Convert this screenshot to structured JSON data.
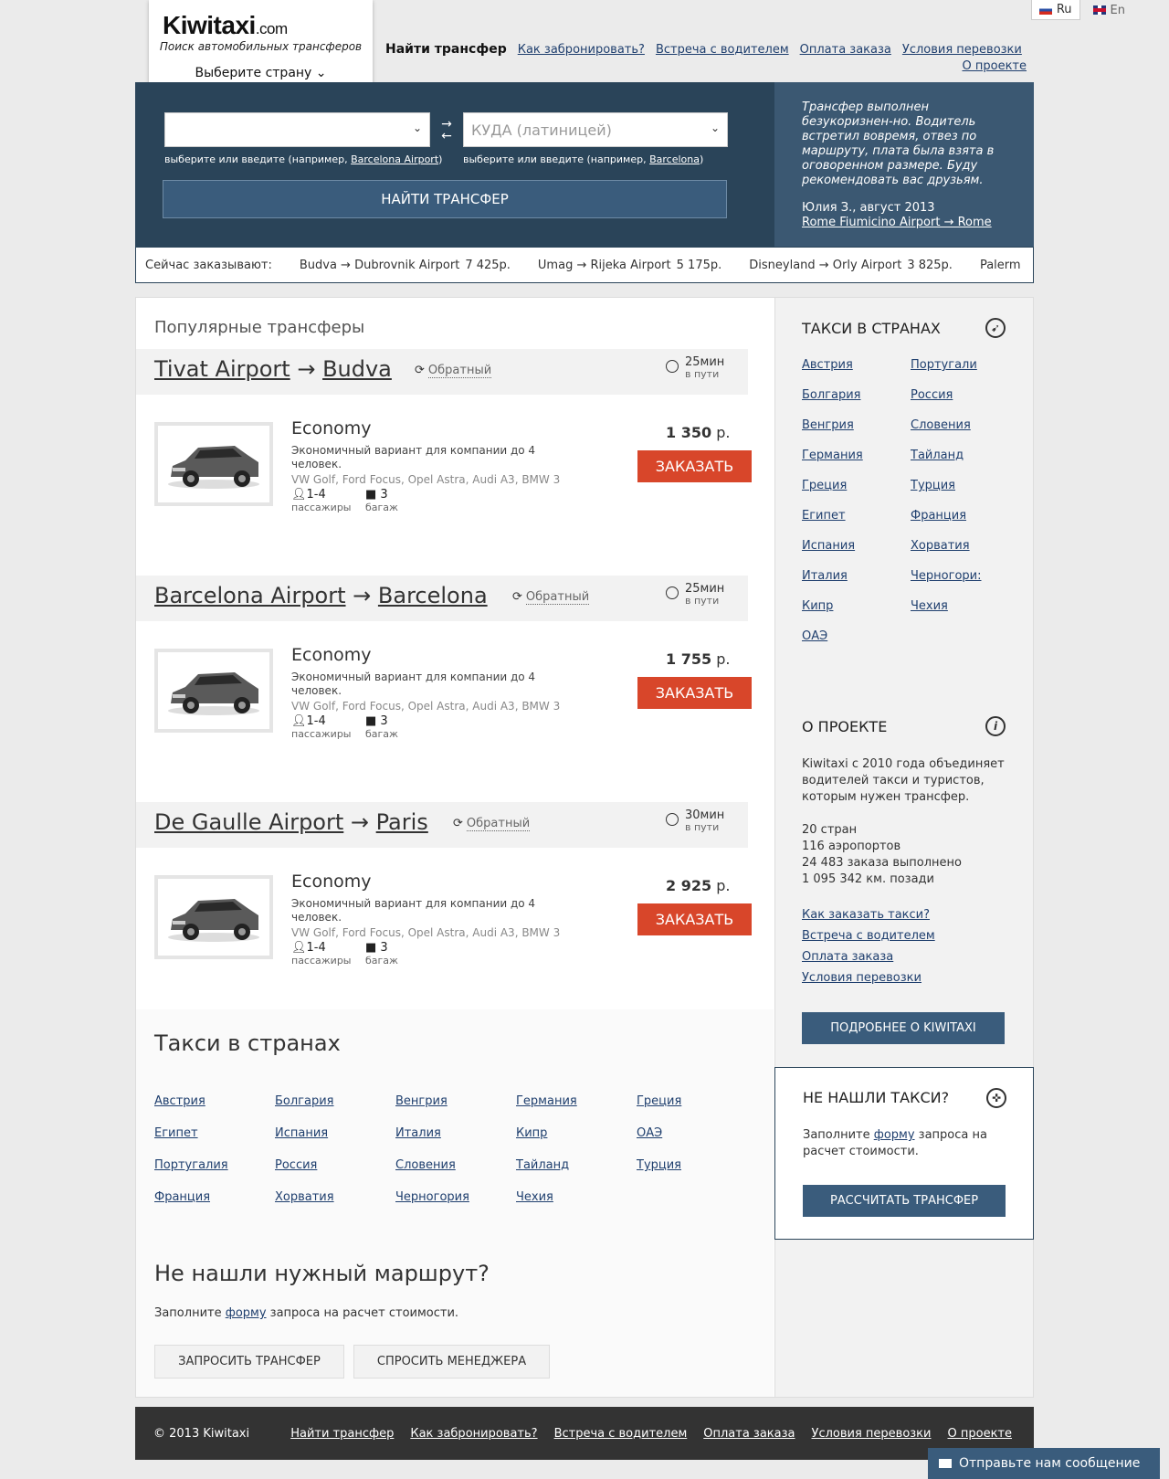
{
  "header": {
    "logo_main": "Kiwitaxi",
    "logo_suffix": ".com",
    "tagline": "Поиск автомобильных трансферов",
    "country_select": "Выберите страну"
  },
  "lang": {
    "ru": "Ru",
    "en": "En"
  },
  "nav": {
    "current": "Найти трансфер",
    "items": [
      "Как забронировать?",
      "Встреча с водителем",
      "Оплата заказа",
      "Условия перевозки"
    ],
    "about": "О проекте"
  },
  "search": {
    "from_value": "",
    "to_placeholder": "КУДА (латиницей)",
    "hint_prefix": "выберите или введите (например, ",
    "hint_suffix": ")",
    "from_example": "Barcelona Airport",
    "to_example": "Barcelona",
    "button": "НАЙТИ ТРАНСФЕР"
  },
  "review": {
    "text": "Трансфер выполнен безукоризнен-но. Водитель встретил вовремя, отвез по маршруту, плата была взята в оговоренном размере. Буду рекомендовать вас друзьям.",
    "author": "Юлия З., август 2013",
    "route": "Rome Fiumicino Airport → Rome"
  },
  "ticker": {
    "label": "Сейчас заказывают:",
    "items": [
      {
        "route": "Budva → Dubrovnik Airport",
        "price": "7 425р."
      },
      {
        "route": "Umag → Rijeka Airport",
        "price": "5 175р."
      },
      {
        "route": "Disneyland → Orly Airport",
        "price": "3 825р."
      },
      {
        "route": "Palerm",
        "price": ""
      }
    ]
  },
  "popular": {
    "title": "Популярные трансферы",
    "return_label": "Обратный",
    "duration_sub": "в пути",
    "routes": [
      {
        "from": "Tivat Airport",
        "to": "Budva",
        "duration": "25мин",
        "car": "Economy",
        "desc": "Экономичный вариант для компании до 4 человек.",
        "models": "VW Golf, Ford Focus, Opel Astra, Audi A3, BMW 3",
        "pax": "1-4",
        "pax_label": "пассажиры",
        "bags": "3",
        "bags_label": "багаж",
        "price": "1 350",
        "currency": "р.",
        "order": "ЗАКАЗАТЬ"
      },
      {
        "from": "Barcelona Airport",
        "to": "Barcelona",
        "duration": "25мин",
        "car": "Economy",
        "desc": "Экономичный вариант для компании до 4 человек.",
        "models": "VW Golf, Ford Focus, Opel Astra, Audi A3, BMW 3",
        "pax": "1-4",
        "pax_label": "пассажиры",
        "bags": "3",
        "bags_label": "багаж",
        "price": "1 755",
        "currency": "р.",
        "order": "ЗАКАЗАТЬ"
      },
      {
        "from": "De Gaulle Airport",
        "to": "Paris",
        "duration": "30мин",
        "car": "Economy",
        "desc": "Экономичный вариант для компании до 4 человек.",
        "models": "VW Golf, Ford Focus, Opel Astra, Audi A3, BMW 3",
        "pax": "1-4",
        "pax_label": "пассажиры",
        "bags": "3",
        "bags_label": "багаж",
        "price": "2 925",
        "currency": "р.",
        "order": "ЗАКАЗАТЬ"
      }
    ]
  },
  "countries": {
    "title": "Такси в странах",
    "items": [
      "Австрия",
      "Болгария",
      "Венгрия",
      "Германия",
      "Греция",
      "Египет",
      "Испания",
      "Италия",
      "Кипр",
      "ОАЭ",
      "Португалия",
      "Россия",
      "Словения",
      "Тайланд",
      "Турция",
      "Франция",
      "Хорватия",
      "Черногория",
      "Чехия"
    ]
  },
  "noroute": {
    "title": "Не нашли нужный маршрут?",
    "text_before": "Заполните ",
    "link": "форму",
    "text_after": " запроса на расчет стоимости.",
    "request_btn": "ЗАПРОСИТЬ ТРАНСФЕР",
    "ask_btn": "СПРОСИТЬ МЕНЕДЖЕРА"
  },
  "sidebar": {
    "countries_title": "ТАКСИ В СТРАНАХ",
    "countries": [
      "Австрия",
      "Португали",
      "Болгария",
      "Россия",
      "Венгрия",
      "Словения",
      "Германия",
      "Тайланд",
      "Греция",
      "Турция",
      "Египет",
      "Франция",
      "Испания",
      "Хорватия",
      "Италия",
      "Черногори:",
      "Кипр",
      "Чехия",
      "ОАЭ"
    ],
    "about_title": "О ПРОЕКТЕ",
    "about_text": "Kiwitaxi с 2010 года объединяет водителей такси и туристов, которым нужен трансфер.",
    "stats": [
      "20 стран",
      "116 аэропортов",
      "24 483 заказа выполнено",
      "1 095 342 км. позади"
    ],
    "links": [
      "Как заказать такси?",
      "Встреча с водителем",
      "Оплата заказа",
      "Условия перевозки"
    ],
    "about_btn": "ПОДРОБНЕЕ О KIWITAXI",
    "notfound_title": "НЕ НАШЛИ ТАКСИ?",
    "notfound_before": "Заполните ",
    "notfound_link": "форму",
    "notfound_after": " запроса на расчет стоимости.",
    "calc_btn": "РАССЧИТАТЬ ТРАНСФЕР"
  },
  "footer": {
    "copyright": "© 2013 Kiwitaxi",
    "links": [
      "Найти трансфер",
      "Как забронировать?",
      "Встреча с водителем",
      "Оплата заказа",
      "Условия перевозки",
      "О проекте"
    ]
  },
  "message_btn": "Отправьте нам сообщение",
  "colors": {
    "header_bg": "#2a4459",
    "accent_order": "#d8462a",
    "button_blue": "#3a5c7c"
  }
}
